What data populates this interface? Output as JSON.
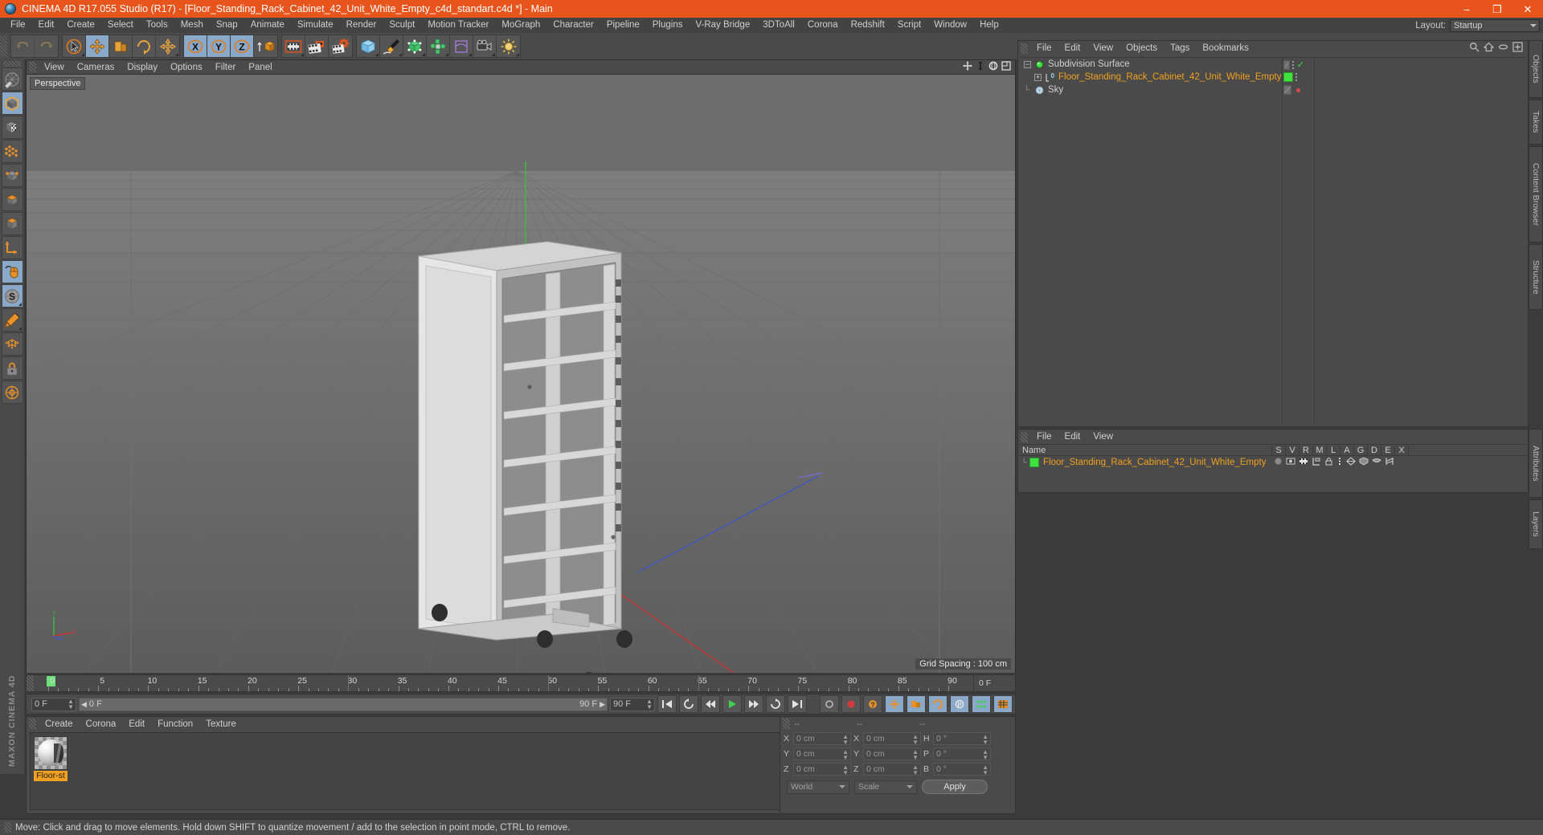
{
  "window": {
    "title": "CINEMA 4D R17.055 Studio (R17) - [Floor_Standing_Rack_Cabinet_42_Unit_White_Empty_c4d_standart.c4d *] - Main",
    "minimize_label": "–",
    "maximize_label": "❐",
    "close_label": "✕",
    "titlebar_color": "#e8551c"
  },
  "menubar": {
    "items": [
      "File",
      "Edit",
      "Create",
      "Select",
      "Tools",
      "Mesh",
      "Snap",
      "Animate",
      "Simulate",
      "Render",
      "Sculpt",
      "Motion Tracker",
      "MoGraph",
      "Character",
      "Pipeline",
      "Plugins",
      "V-Ray Bridge",
      "3DToAll",
      "Corona",
      "Redshift",
      "Script",
      "Window",
      "Help"
    ],
    "layout_label": "Layout:",
    "layout_value": "Startup"
  },
  "toolbar": {
    "groups": [
      {
        "name": "history",
        "buttons": [
          {
            "name": "undo-icon",
            "label": "Undo",
            "state": "disabled"
          },
          {
            "name": "redo-icon",
            "label": "Redo",
            "state": "disabled"
          }
        ]
      },
      {
        "name": "transform",
        "buttons": [
          {
            "name": "select-cursor-icon",
            "label": "Live Selection",
            "state": "normal"
          },
          {
            "name": "move-icon",
            "label": "Move",
            "state": "active"
          },
          {
            "name": "scale-icon",
            "label": "Scale",
            "state": "normal"
          },
          {
            "name": "rotate-icon",
            "label": "Rotate",
            "state": "normal"
          },
          {
            "name": "axis-move-icon",
            "label": "Move Axis",
            "state": "normal"
          }
        ]
      },
      {
        "name": "axis-lock",
        "buttons": [
          {
            "name": "x-axis-icon",
            "label": "X",
            "state": "active"
          },
          {
            "name": "y-axis-icon",
            "label": "Y",
            "state": "active"
          },
          {
            "name": "z-axis-icon",
            "label": "Z",
            "state": "active"
          },
          {
            "name": "world-object-axis-icon",
            "label": "World/Object",
            "state": "normal"
          }
        ]
      },
      {
        "name": "render",
        "buttons": [
          {
            "name": "render-view-icon",
            "label": "Render View",
            "state": "normal"
          },
          {
            "name": "render-to-picture-viewer-icon",
            "label": "Render to Picture Viewer",
            "state": "normal"
          },
          {
            "name": "render-settings-icon",
            "label": "Edit Render Settings",
            "state": "normal"
          }
        ]
      },
      {
        "name": "create",
        "buttons": [
          {
            "name": "cube-primitive-icon",
            "label": "Add Cube Object",
            "state": "normal"
          },
          {
            "name": "spline-pen-icon",
            "label": "Add Spline",
            "state": "normal"
          },
          {
            "name": "generator-icon",
            "label": "Add NURBS Object",
            "state": "normal"
          },
          {
            "name": "scene-objects-icon",
            "label": "Add Scene Object",
            "state": "normal"
          },
          {
            "name": "deformer-icon",
            "label": "Add Deformer",
            "state": "normal"
          },
          {
            "name": "camera-icon",
            "label": "Add Camera",
            "state": "normal"
          },
          {
            "name": "light-icon",
            "label": "Add Light",
            "state": "normal"
          }
        ]
      }
    ]
  },
  "left_toolbar": {
    "buttons": [
      {
        "name": "make-editable-icon",
        "label": "Make Editable",
        "state": "normal"
      },
      {
        "name": "model-mode-icon",
        "label": "Model Mode",
        "state": "active"
      },
      {
        "name": "texture-mode-icon",
        "label": "Texture Mode",
        "state": "normal"
      },
      {
        "name": "points-mode-icon",
        "label": "Points Mode",
        "state": "normal"
      },
      {
        "name": "edges-mode-icon",
        "label": "Edges Mode",
        "state": "normal"
      },
      {
        "name": "polygons-mode-icon",
        "label": "Polygons Mode",
        "state": "normal"
      },
      {
        "name": "axis-mode-icon",
        "label": "Enable Axis Modification",
        "state": "normal"
      },
      {
        "name": "viewport-solo-icon",
        "label": "Viewport Solo",
        "state": "active"
      },
      {
        "name": "snap-icon",
        "label": "Enable Snapping",
        "state": "active"
      },
      {
        "name": "workplane-icon",
        "label": "Workplane",
        "state": "normal"
      },
      {
        "name": "lock-workplane-icon",
        "label": "Lock Workplane",
        "state": "normal"
      },
      {
        "name": "planar-workplane-icon",
        "label": "Planar Workplane",
        "state": "normal"
      }
    ],
    "brand": "MAXON CINEMA 4D"
  },
  "viewport": {
    "menu": [
      "View",
      "Cameras",
      "Display",
      "Options",
      "Filter",
      "Panel"
    ],
    "nav_icons": [
      "pan-icon",
      "dolly-icon",
      "orbit-icon",
      "maximize-viewport-icon"
    ],
    "camera_label": "Perspective",
    "grid_spacing": "Grid Spacing : 100 cm",
    "axis_labels": {
      "x": "X",
      "y": "Y",
      "z": "Z"
    }
  },
  "timeline": {
    "ticks": [
      0,
      5,
      10,
      15,
      20,
      25,
      30,
      35,
      40,
      45,
      50,
      55,
      60,
      65,
      70,
      75,
      80,
      85,
      90
    ],
    "current_frame_label": "0 F",
    "end_label": "0 F",
    "playhead_frame": 0
  },
  "transport": {
    "current_frame": "0 F",
    "range_start": "0 F",
    "range_end": "90 F",
    "preview_end": "90 F",
    "buttons": [
      {
        "name": "go-to-start-button",
        "label": "⏮",
        "state": "normal"
      },
      {
        "name": "step-back-keyframe-button",
        "label": "↺",
        "state": "normal"
      },
      {
        "name": "step-back-frame-button",
        "label": "◀◀",
        "state": "normal"
      },
      {
        "name": "play-button",
        "label": "▶",
        "state": "play"
      },
      {
        "name": "step-forward-frame-button",
        "label": "▶▶",
        "state": "normal"
      },
      {
        "name": "step-forward-keyframe-button",
        "label": "↻",
        "state": "normal"
      },
      {
        "name": "go-to-end-button",
        "label": "⏭",
        "state": "normal"
      }
    ],
    "record_buttons": [
      {
        "name": "autokeying-icon",
        "label": "Autokeying",
        "state": "normal"
      },
      {
        "name": "record-active-objects-icon",
        "label": "Record Active Objects",
        "state": "record"
      },
      {
        "name": "keyframe-selection-icon",
        "label": "Keyframe Selection",
        "state": "warn"
      },
      {
        "name": "position-key-icon",
        "label": "Position",
        "state": "on"
      },
      {
        "name": "scale-key-icon",
        "label": "Scale",
        "state": "on"
      },
      {
        "name": "rotation-key-icon",
        "label": "Rotation",
        "state": "on"
      },
      {
        "name": "parameter-key-icon",
        "label": "Parameter",
        "state": "on"
      },
      {
        "name": "pla-key-icon",
        "label": "Point Level Animation",
        "state": "on"
      },
      {
        "name": "timeline-toggle-icon",
        "label": "Timeline",
        "state": "on"
      }
    ]
  },
  "material_manager": {
    "menu": [
      "Create",
      "Corona",
      "Edit",
      "Function",
      "Texture"
    ],
    "materials": [
      {
        "name": "Floor-st",
        "selected": true
      }
    ]
  },
  "coordinates": {
    "headers": [
      "--",
      "--",
      "--"
    ],
    "rows": [
      {
        "pos_label": "X",
        "pos_value": "0 cm",
        "size_label": "X",
        "size_value": "0 cm",
        "rot_label": "H",
        "rot_value": "0 °"
      },
      {
        "pos_label": "Y",
        "pos_value": "0 cm",
        "size_label": "Y",
        "size_value": "0 cm",
        "rot_label": "P",
        "rot_value": "0 °"
      },
      {
        "pos_label": "Z",
        "pos_value": "0 cm",
        "size_label": "Z",
        "size_value": "0 cm",
        "rot_label": "B",
        "rot_value": "0 °"
      }
    ],
    "system": "World",
    "mode": "Scale",
    "apply_label": "Apply"
  },
  "object_manager": {
    "menu": [
      "File",
      "Edit",
      "View",
      "Objects",
      "Tags",
      "Bookmarks"
    ],
    "right_icons": [
      "search-icon",
      "home-icon",
      "ellipse-icon",
      "add-icon"
    ],
    "rows": [
      {
        "name": "Subdivision Surface",
        "icon": "subdivision-surface-icon",
        "indent": 0,
        "expander": "-",
        "color": "grey",
        "vis": "half",
        "dots": true,
        "check": true
      },
      {
        "name": "Floor_Standing_Rack_Cabinet_42_Unit_White_Empty",
        "icon": "null-object-icon",
        "indent": 1,
        "expander": "+",
        "color": "orange",
        "vis": "green",
        "dots": true,
        "check": false
      },
      {
        "name": "Sky",
        "icon": "sky-object-icon",
        "indent": 0,
        "expander": "",
        "color": "grey",
        "vis": "half",
        "dots": false,
        "red": true
      }
    ]
  },
  "tag_manager": {
    "menu": [
      "File",
      "Edit",
      "View"
    ],
    "columns": [
      "Name",
      "S",
      "V",
      "R",
      "M",
      "L",
      "A",
      "G",
      "D",
      "E",
      "X"
    ],
    "rows": [
      {
        "name": "Floor_Standing_Rack_Cabinet_42_Unit_White_Empty",
        "color": "orange"
      }
    ]
  },
  "right_tabs": [
    {
      "name": "objects-tab",
      "label": "Objects"
    },
    {
      "name": "takes-tab",
      "label": "Takes"
    },
    {
      "name": "content-browser-tab",
      "label": "Content Browser"
    },
    {
      "name": "structure-tab",
      "label": "Structure"
    },
    {
      "name": "attributes-tab",
      "label": "Attributes"
    },
    {
      "name": "layers-tab",
      "label": "Layers"
    }
  ],
  "statusbar": {
    "text": "Move: Click and drag to move elements. Hold down SHIFT to quantize movement / add to the selection in point mode, CTRL to remove."
  },
  "colors": {
    "accent_orange": "#e8551c",
    "active_blue": "#8aa8c8",
    "label_orange": "#f0a020",
    "panel_bg": "#4a4a4a",
    "selection_green": "#3fe03f"
  }
}
